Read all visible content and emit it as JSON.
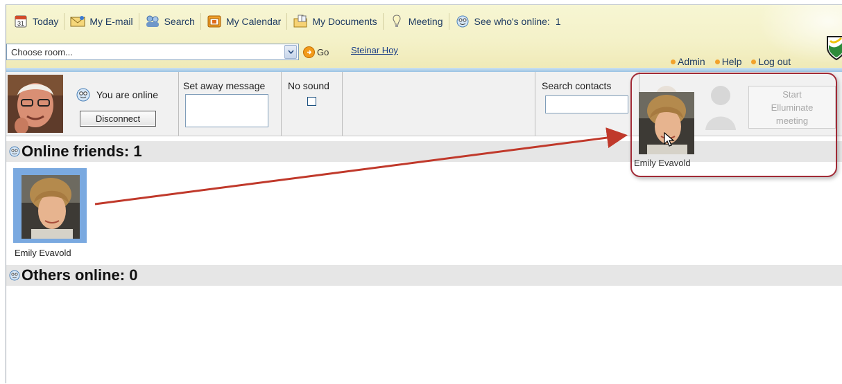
{
  "toolbar": {
    "items": [
      {
        "label": "Today",
        "icon": "calendar-day-icon"
      },
      {
        "label": "My E-mail",
        "icon": "envelope-icon"
      },
      {
        "label": "Search",
        "icon": "people-search-icon"
      },
      {
        "label": "My Calendar",
        "icon": "calendar-icon"
      },
      {
        "label": "My Documents",
        "icon": "folder-icon"
      },
      {
        "label": "Meeting",
        "icon": "lightbulb-icon"
      },
      {
        "label": "See who's online:",
        "icon": "smiley-icon"
      }
    ],
    "online_count": "1",
    "today_day": "31"
  },
  "room": {
    "placeholder": "Choose room...",
    "go_label": "Go",
    "user_name": "Steinar Hoy"
  },
  "top_links": {
    "admin": "Admin",
    "help": "Help",
    "logout": "Log out"
  },
  "status": {
    "online_text": "You are online",
    "disconnect_label": "Disconnect",
    "away_label": "Set away message",
    "sound_label": "No sound",
    "search_label": "Search contacts",
    "meeting_button": [
      "Start",
      "Elluminate",
      "meeting"
    ]
  },
  "sections": {
    "friends_title": "Online friends: 1",
    "others_title": "Others online: 0"
  },
  "friends": [
    {
      "name": "Emily Evavold"
    }
  ],
  "drag": {
    "name": "Emily Evavold"
  },
  "colors": {
    "toolbar_bg": "#f4f1c8",
    "accent_blue": "#7aa9e0",
    "highlight": "#a12a36",
    "arrow": "#c0392b"
  }
}
